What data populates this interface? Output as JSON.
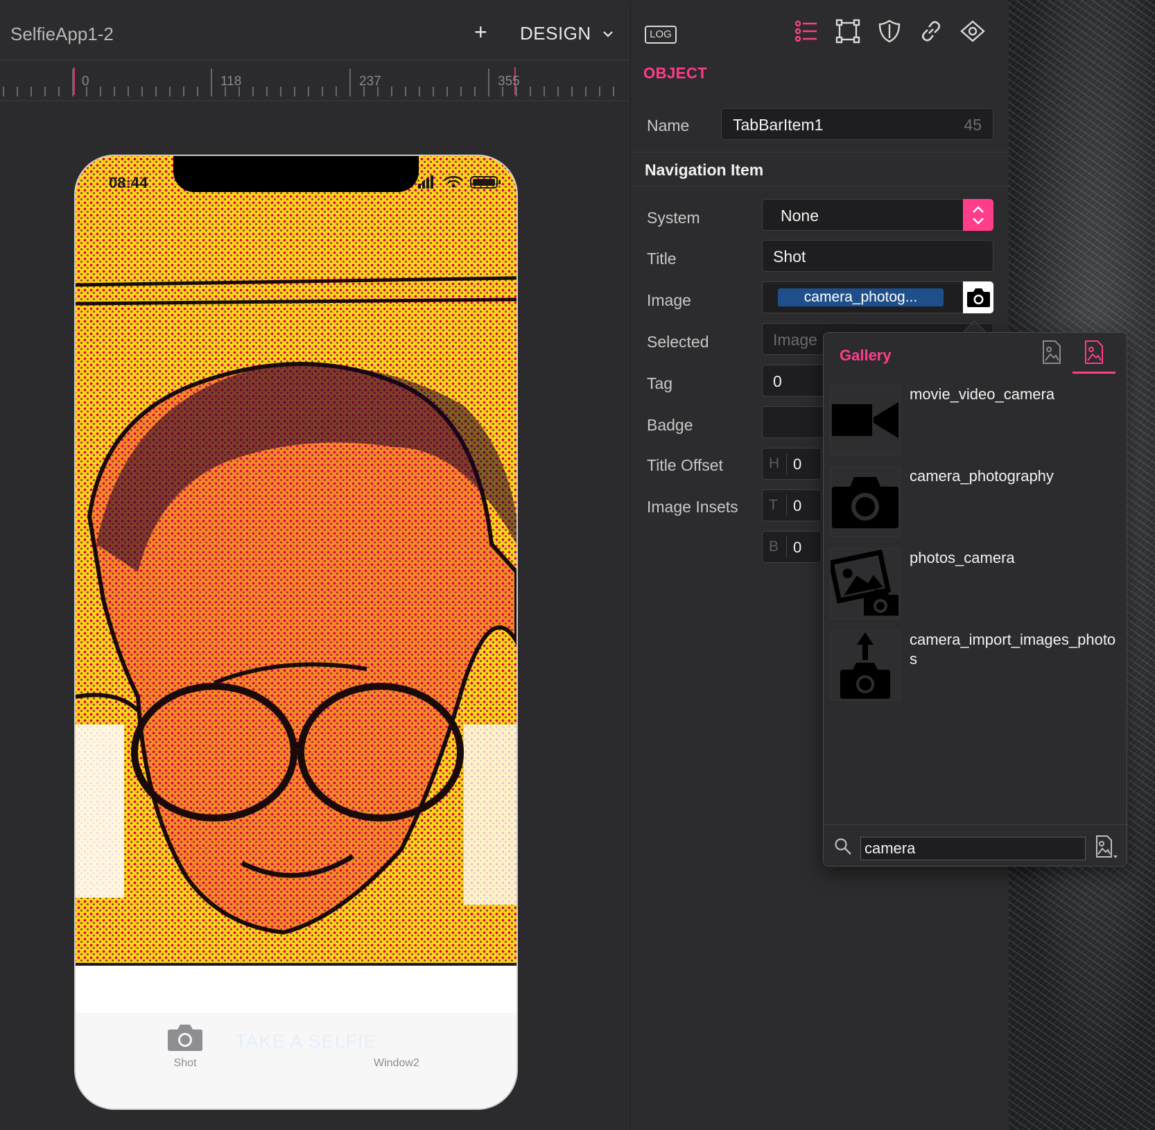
{
  "canvas": {
    "project_title": "SelfieApp1-2",
    "add_label": "+",
    "mode_label": "DESIGN",
    "ruler_labels": [
      "0",
      "118",
      "237",
      "355"
    ]
  },
  "phone": {
    "status_time": "08:44",
    "overlay_text": "TAKE A SELFIE",
    "tabs": [
      {
        "label": "Shot",
        "icon": "camera-icon"
      },
      {
        "label": "Window2"
      }
    ]
  },
  "inspector": {
    "log_label": "LOG",
    "toolbar_icons": [
      "list-icon",
      "frame-icon",
      "shield-icon",
      "link-icon",
      "eye-icon"
    ],
    "section_object": "OBJECT",
    "name_label": "Name",
    "name_value": "TabBarItem1",
    "name_count": "45",
    "section_nav": "Navigation Item",
    "system_label": "System",
    "system_value": "None",
    "title_label": "Title",
    "title_value": "Shot",
    "image_label": "Image",
    "image_value": "camera_photog...",
    "selected_label": "Selected",
    "selected_placeholder": "Image",
    "tag_label": "Tag",
    "tag_value": "0",
    "badge_label": "Badge",
    "badge_value": "",
    "title_offset_label": "Title Offset",
    "title_offset_h_prefix": "H",
    "title_offset_h": "0",
    "image_insets_label": "Image Insets",
    "image_insets_t_prefix": "T",
    "image_insets_t": "0",
    "image_insets_b_prefix": "B",
    "image_insets_b": "0"
  },
  "gallery": {
    "title": "Gallery",
    "items": [
      {
        "label": "movie_video_camera"
      },
      {
        "label": "camera_photography"
      },
      {
        "label": "photos_camera"
      },
      {
        "label": "camera_import_images_photos"
      }
    ],
    "search_value": "camera"
  },
  "colors": {
    "accent": "#ff3d8b",
    "panel": "#2c2c2e",
    "chip": "#1f4f8a"
  }
}
